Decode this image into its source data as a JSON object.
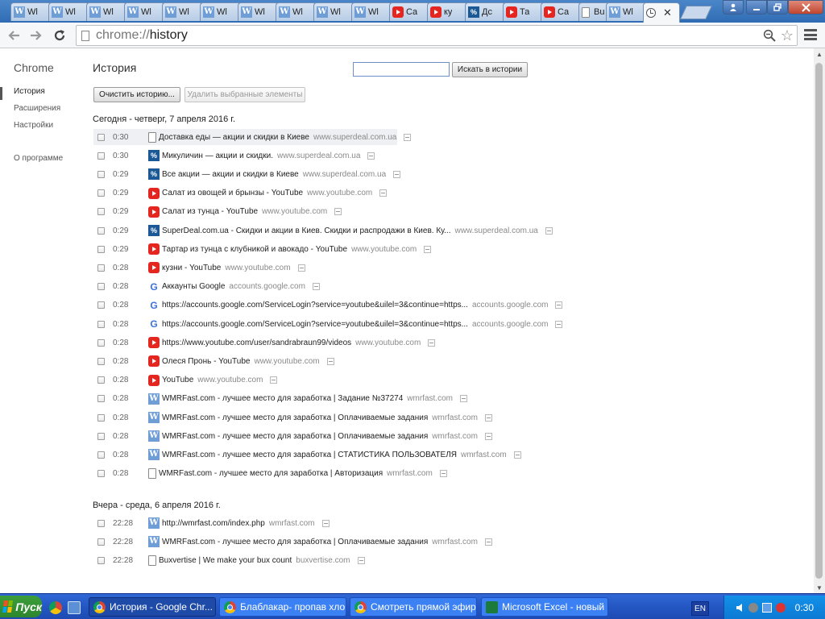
{
  "browser": {
    "tabs": [
      {
        "label": "Wl",
        "icon": "w"
      },
      {
        "label": "Wl",
        "icon": "w"
      },
      {
        "label": "Wl",
        "icon": "w"
      },
      {
        "label": "Wl",
        "icon": "w"
      },
      {
        "label": "Wl",
        "icon": "w"
      },
      {
        "label": "Wl",
        "icon": "w"
      },
      {
        "label": "Wl",
        "icon": "w"
      },
      {
        "label": "Wl",
        "icon": "w"
      },
      {
        "label": "Wl",
        "icon": "w"
      },
      {
        "label": "Wl",
        "icon": "w"
      },
      {
        "label": "Ca",
        "icon": "youtube"
      },
      {
        "label": "ку",
        "icon": "youtube"
      },
      {
        "label": "Дс",
        "icon": "superdeal"
      },
      {
        "label": "Та",
        "icon": "youtube"
      },
      {
        "label": "Ca",
        "icon": "youtube"
      },
      {
        "label": "Bu",
        "icon": "document"
      },
      {
        "label": "Wl",
        "icon": "w"
      }
    ],
    "active_tab_close": "✕",
    "url_scheme": "chrome://",
    "url_path": "history"
  },
  "sidebar": {
    "brand": "Chrome",
    "items": [
      {
        "label": "История"
      },
      {
        "label": "Расширения"
      },
      {
        "label": "Настройки"
      }
    ],
    "about": "О программе"
  },
  "page": {
    "title": "История",
    "search_button": "Искать в истории",
    "search_value": "",
    "clear_button": "Очистить историю...",
    "remove_button": "Удалить выбранные элементы"
  },
  "days": [
    {
      "heading": "Сегодня - четверг, 7 апреля 2016 г.",
      "entries": [
        {
          "time": "0:30",
          "title": "Доставка еды — акции и скидки в Киеве",
          "domain": "www.superdeal.com.ua",
          "icon": "document"
        },
        {
          "time": "0:30",
          "title": "Микуличин — акции и скидки.",
          "domain": "www.superdeal.com.ua",
          "icon": "superdeal"
        },
        {
          "time": "0:29",
          "title": "Все акции — акции и скидки в Киеве",
          "domain": "www.superdeal.com.ua",
          "icon": "superdeal"
        },
        {
          "time": "0:29",
          "title": "Салат из овощей и брынзы - YouTube",
          "domain": "www.youtube.com",
          "icon": "youtube"
        },
        {
          "time": "0:29",
          "title": "Салат из тунца - YouTube",
          "domain": "www.youtube.com",
          "icon": "youtube"
        },
        {
          "time": "0:29",
          "title": "SuperDeal.com.ua - Скидки и акции в Киев. Скидки и распродажи в Киев. Ку...",
          "domain": "www.superdeal.com.ua",
          "icon": "superdeal"
        },
        {
          "time": "0:29",
          "title": "Тартар из тунца с клубникой и авокадо - YouTube",
          "domain": "www.youtube.com",
          "icon": "youtube"
        },
        {
          "time": "0:28",
          "title": "кузни - YouTube",
          "domain": "www.youtube.com",
          "icon": "youtube"
        },
        {
          "time": "0:28",
          "title": "Аккаунты Google",
          "domain": "accounts.google.com",
          "icon": "google"
        },
        {
          "time": "0:28",
          "title": "https://accounts.google.com/ServiceLogin?service=youtube&uilel=3&continue=https...",
          "domain": "accounts.google.com",
          "icon": "google"
        },
        {
          "time": "0:28",
          "title": "https://accounts.google.com/ServiceLogin?service=youtube&uilel=3&continue=https...",
          "domain": "accounts.google.com",
          "icon": "google"
        },
        {
          "time": "0:28",
          "title": "https://www.youtube.com/user/sandrabraun99/videos",
          "domain": "www.youtube.com",
          "icon": "youtube"
        },
        {
          "time": "0:28",
          "title": "Олеся Пронь - YouTube",
          "domain": "www.youtube.com",
          "icon": "youtube"
        },
        {
          "time": "0:28",
          "title": "YouTube",
          "domain": "www.youtube.com",
          "icon": "youtube"
        },
        {
          "time": "0:28",
          "title": "WMRFast.com - лучшее место для заработка | Задание №37274",
          "domain": "wmrfast.com",
          "icon": "w"
        },
        {
          "time": "0:28",
          "title": "WMRFast.com - лучшее место для заработка | Оплачиваемые задания",
          "domain": "wmrfast.com",
          "icon": "w"
        },
        {
          "time": "0:28",
          "title": "WMRFast.com - лучшее место для заработка | Оплачиваемые задания",
          "domain": "wmrfast.com",
          "icon": "w"
        },
        {
          "time": "0:28",
          "title": "WMRFast.com - лучшее место для заработка | СТАТИСТИКА ПОЛЬЗОВАТЕЛЯ",
          "domain": "wmrfast.com",
          "icon": "w"
        },
        {
          "time": "0:28",
          "title": "WMRFast.com - лучшее место для заработка | Авторизация",
          "domain": "wmrfast.com",
          "icon": "document"
        }
      ]
    },
    {
      "heading": "Вчера - среда, 6 апреля 2016 г.",
      "entries": [
        {
          "time": "22:28",
          "title": "http://wmrfast.com/index.php",
          "domain": "wmrfast.com",
          "icon": "w"
        },
        {
          "time": "22:28",
          "title": "WMRFast.com - лучшее место для заработка | Оплачиваемые задания",
          "domain": "wmrfast.com",
          "icon": "w"
        },
        {
          "time": "22:28",
          "title": "Buxvertise | We make your bux count",
          "domain": "buxvertise.com",
          "icon": "document"
        }
      ]
    }
  ],
  "taskbar": {
    "start_label": "Пуск",
    "tasks": [
      {
        "label": "История - Google Chr...",
        "icon": "chrome"
      },
      {
        "label": "Блаблакар- пропав хло...",
        "icon": "chrome"
      },
      {
        "label": "Смотреть прямой эфир ...",
        "icon": "chrome"
      },
      {
        "label": "Microsoft Excel - новый ...",
        "icon": "excel"
      }
    ],
    "language": "EN",
    "clock": "0:30"
  },
  "colors": {
    "tabstrip": "#2f6cb4",
    "youtube_red": "#e52620",
    "superdeal_blue": "#1a5896",
    "wmr_blue": "#6f9ed6",
    "taskbar_blue": "#2457c3",
    "start_green": "#2d862d"
  }
}
